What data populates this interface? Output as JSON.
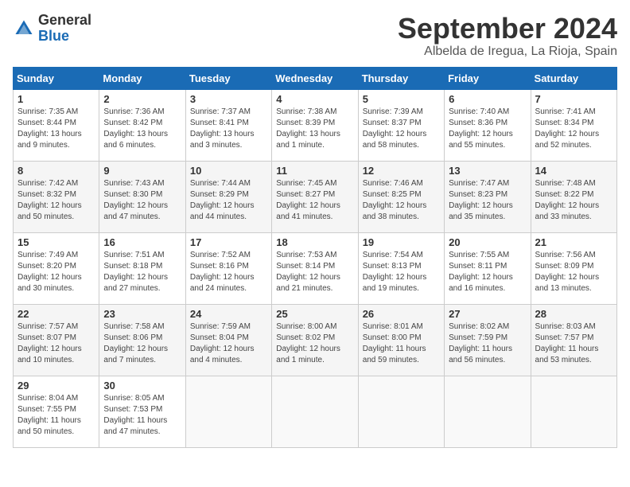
{
  "header": {
    "logo_general": "General",
    "logo_blue": "Blue",
    "month": "September 2024",
    "location": "Albelda de Iregua, La Rioja, Spain"
  },
  "weekdays": [
    "Sunday",
    "Monday",
    "Tuesday",
    "Wednesday",
    "Thursday",
    "Friday",
    "Saturday"
  ],
  "weeks": [
    [
      {
        "day": "1",
        "info": "Sunrise: 7:35 AM\nSunset: 8:44 PM\nDaylight: 13 hours\nand 9 minutes."
      },
      {
        "day": "2",
        "info": "Sunrise: 7:36 AM\nSunset: 8:42 PM\nDaylight: 13 hours\nand 6 minutes."
      },
      {
        "day": "3",
        "info": "Sunrise: 7:37 AM\nSunset: 8:41 PM\nDaylight: 13 hours\nand 3 minutes."
      },
      {
        "day": "4",
        "info": "Sunrise: 7:38 AM\nSunset: 8:39 PM\nDaylight: 13 hours\nand 1 minute."
      },
      {
        "day": "5",
        "info": "Sunrise: 7:39 AM\nSunset: 8:37 PM\nDaylight: 12 hours\nand 58 minutes."
      },
      {
        "day": "6",
        "info": "Sunrise: 7:40 AM\nSunset: 8:36 PM\nDaylight: 12 hours\nand 55 minutes."
      },
      {
        "day": "7",
        "info": "Sunrise: 7:41 AM\nSunset: 8:34 PM\nDaylight: 12 hours\nand 52 minutes."
      }
    ],
    [
      {
        "day": "8",
        "info": "Sunrise: 7:42 AM\nSunset: 8:32 PM\nDaylight: 12 hours\nand 50 minutes."
      },
      {
        "day": "9",
        "info": "Sunrise: 7:43 AM\nSunset: 8:30 PM\nDaylight: 12 hours\nand 47 minutes."
      },
      {
        "day": "10",
        "info": "Sunrise: 7:44 AM\nSunset: 8:29 PM\nDaylight: 12 hours\nand 44 minutes."
      },
      {
        "day": "11",
        "info": "Sunrise: 7:45 AM\nSunset: 8:27 PM\nDaylight: 12 hours\nand 41 minutes."
      },
      {
        "day": "12",
        "info": "Sunrise: 7:46 AM\nSunset: 8:25 PM\nDaylight: 12 hours\nand 38 minutes."
      },
      {
        "day": "13",
        "info": "Sunrise: 7:47 AM\nSunset: 8:23 PM\nDaylight: 12 hours\nand 35 minutes."
      },
      {
        "day": "14",
        "info": "Sunrise: 7:48 AM\nSunset: 8:22 PM\nDaylight: 12 hours\nand 33 minutes."
      }
    ],
    [
      {
        "day": "15",
        "info": "Sunrise: 7:49 AM\nSunset: 8:20 PM\nDaylight: 12 hours\nand 30 minutes."
      },
      {
        "day": "16",
        "info": "Sunrise: 7:51 AM\nSunset: 8:18 PM\nDaylight: 12 hours\nand 27 minutes."
      },
      {
        "day": "17",
        "info": "Sunrise: 7:52 AM\nSunset: 8:16 PM\nDaylight: 12 hours\nand 24 minutes."
      },
      {
        "day": "18",
        "info": "Sunrise: 7:53 AM\nSunset: 8:14 PM\nDaylight: 12 hours\nand 21 minutes."
      },
      {
        "day": "19",
        "info": "Sunrise: 7:54 AM\nSunset: 8:13 PM\nDaylight: 12 hours\nand 19 minutes."
      },
      {
        "day": "20",
        "info": "Sunrise: 7:55 AM\nSunset: 8:11 PM\nDaylight: 12 hours\nand 16 minutes."
      },
      {
        "day": "21",
        "info": "Sunrise: 7:56 AM\nSunset: 8:09 PM\nDaylight: 12 hours\nand 13 minutes."
      }
    ],
    [
      {
        "day": "22",
        "info": "Sunrise: 7:57 AM\nSunset: 8:07 PM\nDaylight: 12 hours\nand 10 minutes."
      },
      {
        "day": "23",
        "info": "Sunrise: 7:58 AM\nSunset: 8:06 PM\nDaylight: 12 hours\nand 7 minutes."
      },
      {
        "day": "24",
        "info": "Sunrise: 7:59 AM\nSunset: 8:04 PM\nDaylight: 12 hours\nand 4 minutes."
      },
      {
        "day": "25",
        "info": "Sunrise: 8:00 AM\nSunset: 8:02 PM\nDaylight: 12 hours\nand 1 minute."
      },
      {
        "day": "26",
        "info": "Sunrise: 8:01 AM\nSunset: 8:00 PM\nDaylight: 11 hours\nand 59 minutes."
      },
      {
        "day": "27",
        "info": "Sunrise: 8:02 AM\nSunset: 7:59 PM\nDaylight: 11 hours\nand 56 minutes."
      },
      {
        "day": "28",
        "info": "Sunrise: 8:03 AM\nSunset: 7:57 PM\nDaylight: 11 hours\nand 53 minutes."
      }
    ],
    [
      {
        "day": "29",
        "info": "Sunrise: 8:04 AM\nSunset: 7:55 PM\nDaylight: 11 hours\nand 50 minutes."
      },
      {
        "day": "30",
        "info": "Sunrise: 8:05 AM\nSunset: 7:53 PM\nDaylight: 11 hours\nand 47 minutes."
      },
      {
        "day": "",
        "info": ""
      },
      {
        "day": "",
        "info": ""
      },
      {
        "day": "",
        "info": ""
      },
      {
        "day": "",
        "info": ""
      },
      {
        "day": "",
        "info": ""
      }
    ]
  ]
}
